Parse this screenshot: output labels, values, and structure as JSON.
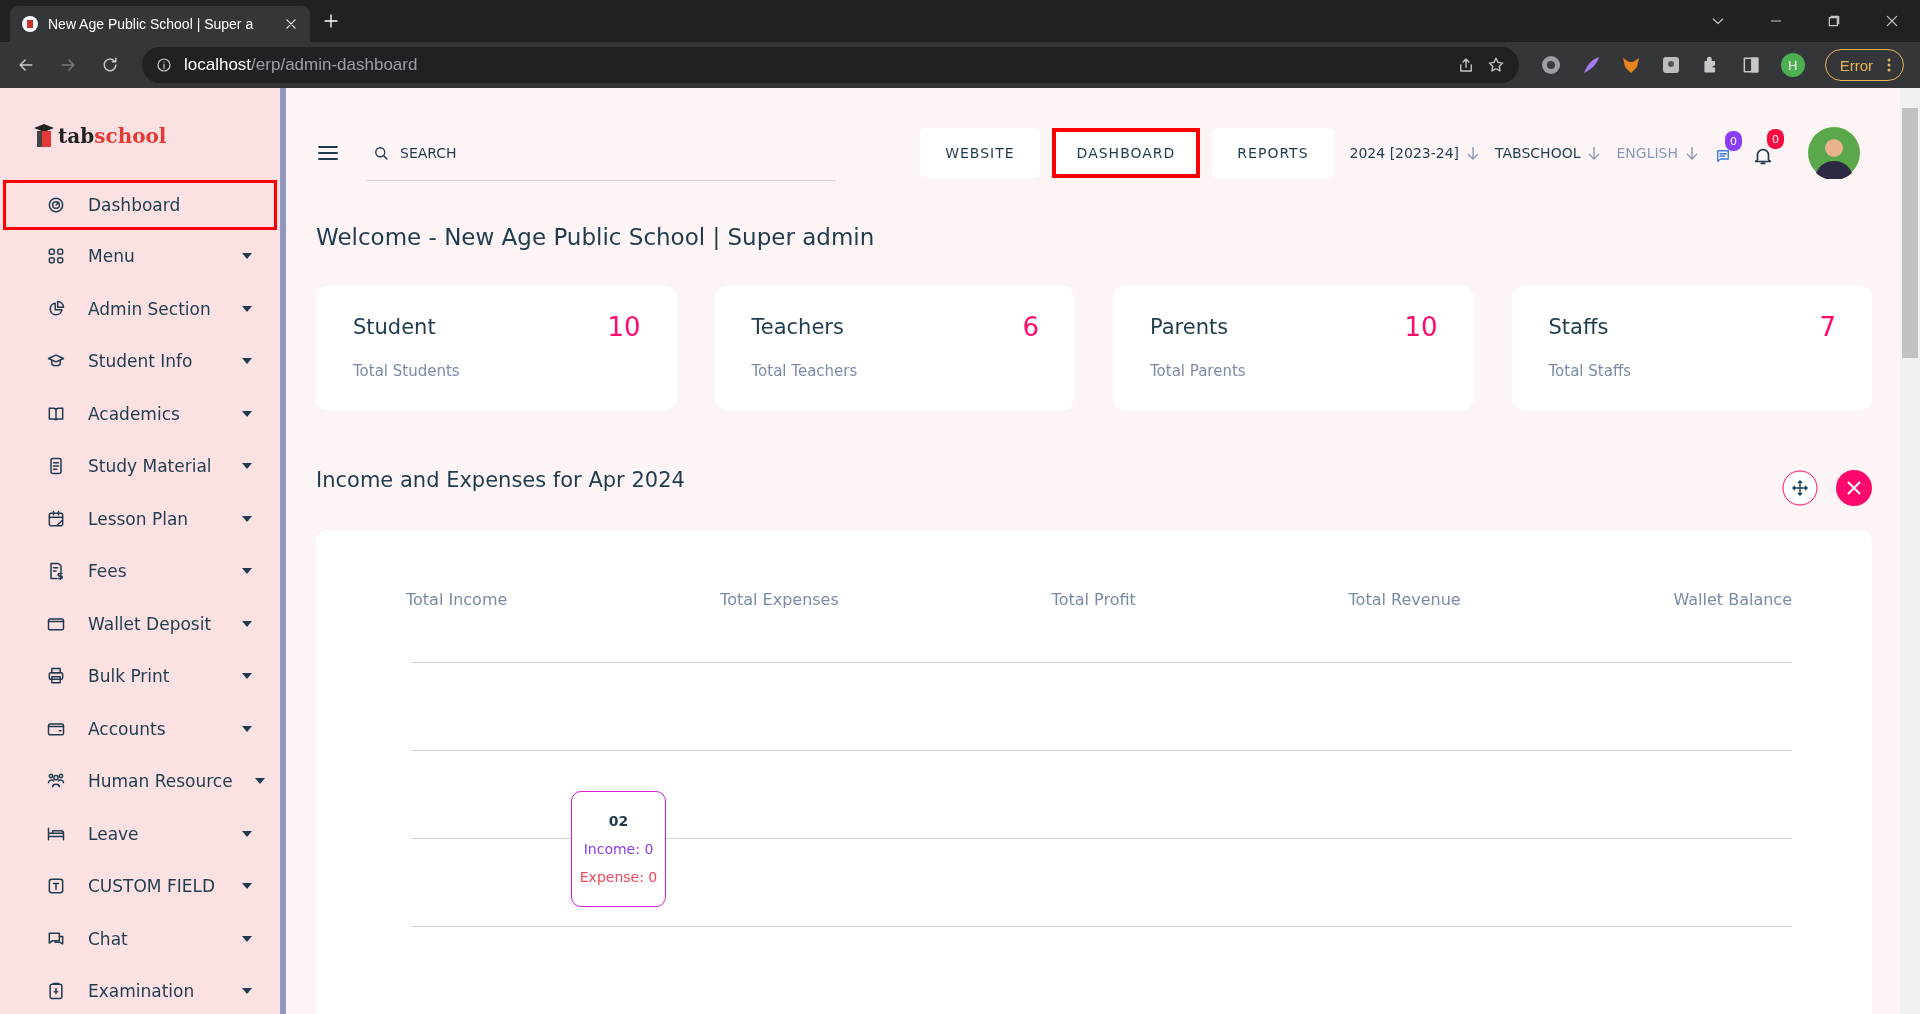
{
  "browser": {
    "tab_title": "New Age Public School | Super a",
    "url_host": "localhost",
    "url_path": "/erp/admin-dashboard",
    "profile_initial": "H",
    "error_label": "Error"
  },
  "sidebar": {
    "logo_a": "tab",
    "logo_b": "school",
    "items": [
      {
        "label": "Dashboard",
        "selected": true,
        "expandable": false
      },
      {
        "label": "Menu",
        "selected": false,
        "expandable": true
      },
      {
        "label": "Admin Section",
        "selected": false,
        "expandable": true
      },
      {
        "label": "Student Info",
        "selected": false,
        "expandable": true
      },
      {
        "label": "Academics",
        "selected": false,
        "expandable": true
      },
      {
        "label": "Study Material",
        "selected": false,
        "expandable": true
      },
      {
        "label": "Lesson Plan",
        "selected": false,
        "expandable": true
      },
      {
        "label": "Fees",
        "selected": false,
        "expandable": true
      },
      {
        "label": "Wallet Deposit",
        "selected": false,
        "expandable": true
      },
      {
        "label": "Bulk Print",
        "selected": false,
        "expandable": true
      },
      {
        "label": "Accounts",
        "selected": false,
        "expandable": true
      },
      {
        "label": "Human Resource",
        "selected": false,
        "expandable": true
      },
      {
        "label": "Leave",
        "selected": false,
        "expandable": true
      },
      {
        "label": "CUSTOM FIELD",
        "selected": false,
        "expandable": true
      },
      {
        "label": "Chat",
        "selected": false,
        "expandable": true
      },
      {
        "label": "Examination",
        "selected": false,
        "expandable": true
      }
    ]
  },
  "header": {
    "search": {
      "placeholder": "SEARCH"
    },
    "nav": [
      {
        "label": "WEBSITE",
        "selected": false
      },
      {
        "label": "DASHBOARD",
        "selected": true
      },
      {
        "label": "REPORTS",
        "selected": false
      }
    ],
    "dropdowns": [
      "2024 [2023-24]",
      "TABSCHOOL",
      "ENGLISH"
    ],
    "chat_badge": "0",
    "notification_badge": "0"
  },
  "welcome": "Welcome - New Age Public School | Super admin",
  "stats": [
    {
      "title": "Student",
      "value": "10",
      "caption": "Total Students"
    },
    {
      "title": "Teachers",
      "value": "6",
      "caption": "Total Teachers"
    },
    {
      "title": "Parents",
      "value": "10",
      "caption": "Total Parents"
    },
    {
      "title": "Staffs",
      "value": "7",
      "caption": "Total Staffs"
    }
  ],
  "income_section": {
    "title": "Income and Expenses for Apr 2024",
    "summary": [
      "Total Income",
      "Total Expenses",
      "Total Profit",
      "Total Revenue",
      "Wallet Balance"
    ],
    "tooltip": {
      "label": "02",
      "income": "Income: 0",
      "expense": "Expense: 0"
    }
  }
}
